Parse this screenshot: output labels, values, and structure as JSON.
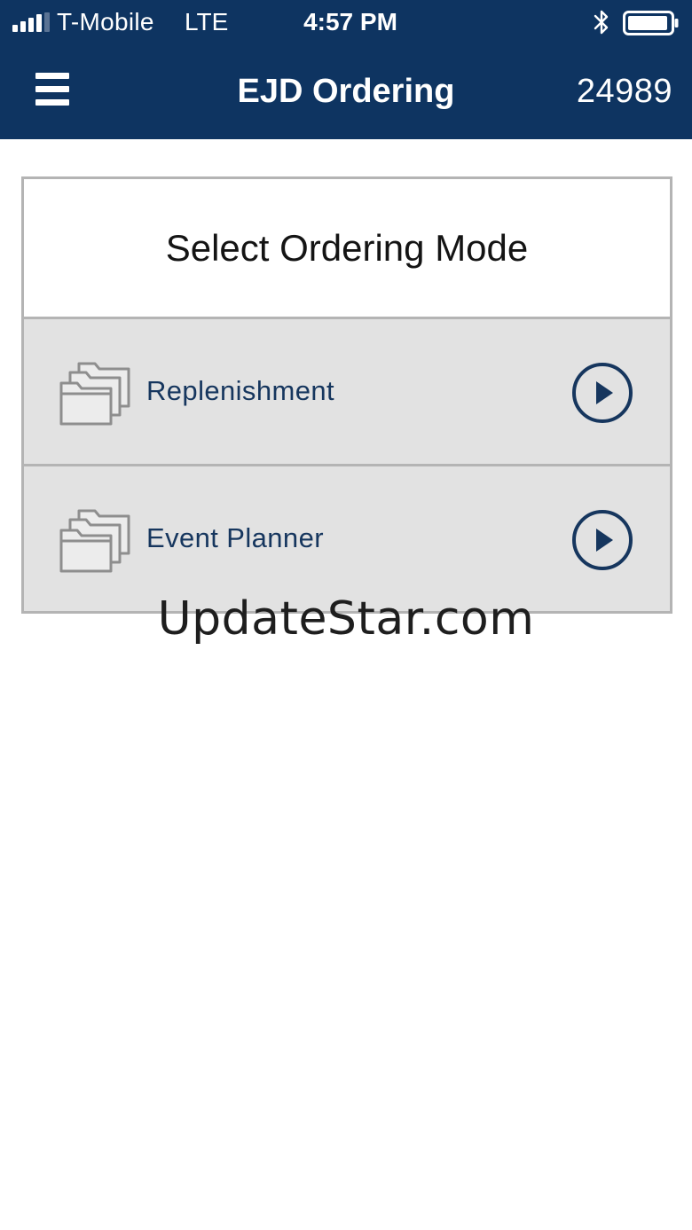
{
  "status_bar": {
    "carrier": "T-Mobile",
    "network": "LTE",
    "time": "4:57 PM"
  },
  "nav": {
    "title": "EJD Ordering",
    "store_number": "24989",
    "menu_icon": "hamburger-menu-icon"
  },
  "card": {
    "title": "Select Ordering Mode",
    "options": [
      {
        "label": "Replenishment",
        "icon": "folder-icon",
        "action_icon": "play-circle-icon"
      },
      {
        "label": "Event Planner",
        "icon": "folder-icon",
        "action_icon": "play-circle-icon"
      }
    ]
  },
  "watermark": "UpdateStar.com",
  "colors": {
    "header_bg": "#0e3461",
    "option_bg": "#e2e2e2",
    "border": "#b4b4b4",
    "accent_text": "#16365e"
  }
}
